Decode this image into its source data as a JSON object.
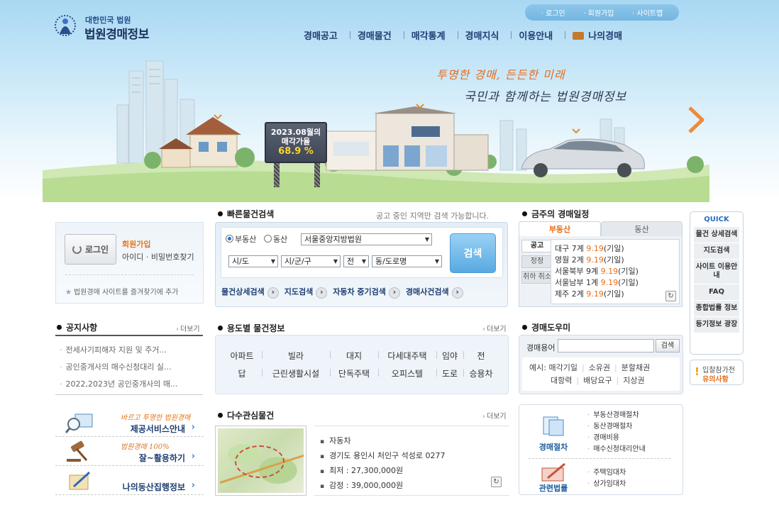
{
  "header": {
    "logo_top": "대한민국 법원",
    "logo_main": "법원경매정보",
    "util": [
      "로그인",
      "회원가입",
      "사이트맵"
    ],
    "gnb": [
      "경매공고",
      "경매물건",
      "매각통계",
      "경매지식",
      "이용안내",
      "나의경매"
    ]
  },
  "hero": {
    "slogan1": "투명한 경매, 든든한 미래",
    "slogan2": "국민과 함께하는 법원경매정보",
    "billboard_line1": "2023.08월의",
    "billboard_line2": "매각가율",
    "billboard_value": "68.9 %",
    "billboard_rate": 68.9
  },
  "login": {
    "button": "로그인",
    "join": "회원가입",
    "find": "아이디 · 비밀번호찾기",
    "favorite": "법원경매 사이트를 즐겨찾기에 추가"
  },
  "quick_search": {
    "title": "빠른물건검색",
    "note": "공고 중인 지역만 검색 가능합니다.",
    "radio1": "부동산",
    "radio2": "동산",
    "court": "서울중앙지방법원",
    "sido": "시/도",
    "sigungu": "시/군/구",
    "all": "전",
    "dong": "동/도로명",
    "search": "검색",
    "links": [
      "물건상세검색",
      "지도검색",
      "자동차 중기검색",
      "경매사건검색"
    ]
  },
  "notice": {
    "title": "공지사항",
    "more": "더보기",
    "items": [
      "전세사기피해자 지원 및 주거...",
      "공인중개사의 매수신청대리 실...",
      "2022,2023년 공인중개사의 매..."
    ]
  },
  "promos": [
    {
      "sub": "바르고 투명한 법원경매",
      "main": "제공서비스안내"
    },
    {
      "sub": "법원경매 100%",
      "main": "잘~활용하기"
    },
    {
      "sub": "",
      "main": "나의동산집행정보"
    }
  ],
  "use_type": {
    "title": "용도별 물건정보",
    "more": "더보기",
    "row1": [
      "아파트",
      "빌라",
      "대지",
      "다세대주택",
      "임야",
      "전"
    ],
    "row2": [
      "답",
      "근린생활시설",
      "단독주택",
      "오피스텔",
      "도로",
      "승용차"
    ]
  },
  "popular": {
    "title": "다수관심물건",
    "more": "더보기",
    "info": [
      "자동차",
      "경기도 용인시 처인구 석성로 0277",
      "최저 : 27,300,000원",
      "감정 : 39,000,000원"
    ]
  },
  "schedule": {
    "title": "금주의 경매일정",
    "tab1": "부동산",
    "tab2": "동산",
    "side": [
      "공고",
      "정정",
      "취하 취소"
    ],
    "items": [
      {
        "court": "대구 7계",
        "date": "9.19",
        "type": "(기일)"
      },
      {
        "court": "영월 2계",
        "date": "9.19",
        "type": "(기일)"
      },
      {
        "court": "서울북부 9계",
        "date": "9.19",
        "type": "(기일)"
      },
      {
        "court": "서울남부 1계",
        "date": "9.19",
        "type": "(기일)"
      },
      {
        "court": "제주 2계",
        "date": "9.19",
        "type": "(기일)"
      }
    ]
  },
  "helper": {
    "title": "경매도우미",
    "label": "경매용어",
    "button": "검색",
    "example_label": "예시:",
    "row1": [
      "매각기일",
      "소유권",
      "분할채권"
    ],
    "row2": [
      "대항력",
      "배당요구",
      "지상권"
    ]
  },
  "procedures": {
    "label1": "경매절차",
    "list1": [
      "부동산경매절차",
      "동산경매절차",
      "경매비용",
      "매수신청대리안내"
    ],
    "label2": "관련법률",
    "list2": [
      "주택임대차",
      "상가임대차"
    ]
  },
  "quick": {
    "title": "QUICK",
    "items": [
      "물건 상세검색",
      "지도검색",
      "사이트 이용안내",
      "FAQ",
      "종합법률 정보",
      "등기정보 광장"
    ],
    "warn1": "입찰참가전",
    "warn2": "유의사항"
  }
}
